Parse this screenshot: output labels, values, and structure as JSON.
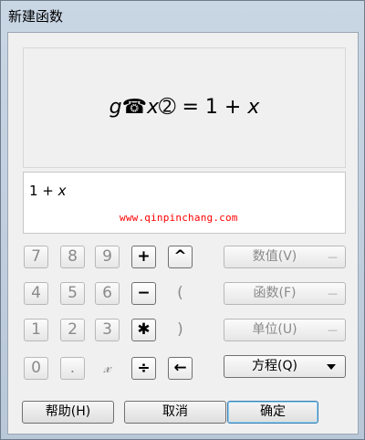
{
  "window": {
    "title": "新建函数"
  },
  "preview": {
    "func": "g",
    "open_glyph": "☎",
    "var": "x",
    "close_glyph": "➁",
    "eq": "= 1 + ",
    "rhs_var": "x"
  },
  "editor": {
    "text_prefix": "1 + ",
    "text_var": "x",
    "watermark": "www.qinpinchang.com"
  },
  "keypad": {
    "k7": "7",
    "k8": "8",
    "k9": "9",
    "plus": "+",
    "caret": "^",
    "k4": "4",
    "k5": "5",
    "k6": "6",
    "minus": "−",
    "lparen": "(",
    "k1": "1",
    "k2": "2",
    "k3": "3",
    "times": "✱",
    "rparen": ")",
    "k0": "0",
    "dot": ".",
    "xvar": "𝓍",
    "divide": "÷",
    "back": "←"
  },
  "side": {
    "value": "数值(V)",
    "function": "函数(F)",
    "unit": "单位(U)",
    "equation": "方程(Q)",
    "dash": "—"
  },
  "footer": {
    "help": "帮助(H)",
    "cancel": "取消",
    "ok": "确定"
  }
}
